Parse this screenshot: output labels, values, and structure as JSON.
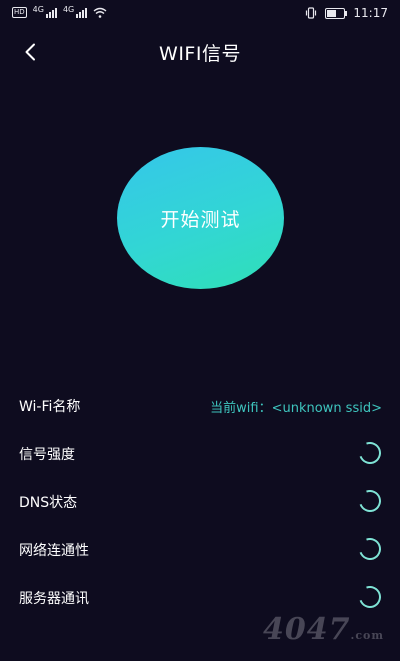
{
  "status_bar": {
    "hd_left": "HD",
    "net1": "4G",
    "net2": "4G",
    "time": "11:17"
  },
  "header": {
    "title": "WIFI信号"
  },
  "start_button": {
    "label": "开始测试"
  },
  "rows": [
    {
      "label": "Wi-Fi名称",
      "value": "当前wifi：<unknown ssid>"
    },
    {
      "label": "信号强度"
    },
    {
      "label": "DNS状态"
    },
    {
      "label": "网络连通性"
    },
    {
      "label": "服务器通讯"
    }
  ],
  "watermark": {
    "text": "4047",
    "suffix": ".com"
  },
  "colors": {
    "background": "#0e0c1f",
    "accent": "#3ec5be",
    "button_gradient_start": "#35c6ea",
    "button_gradient_end": "#2fe0b6"
  }
}
